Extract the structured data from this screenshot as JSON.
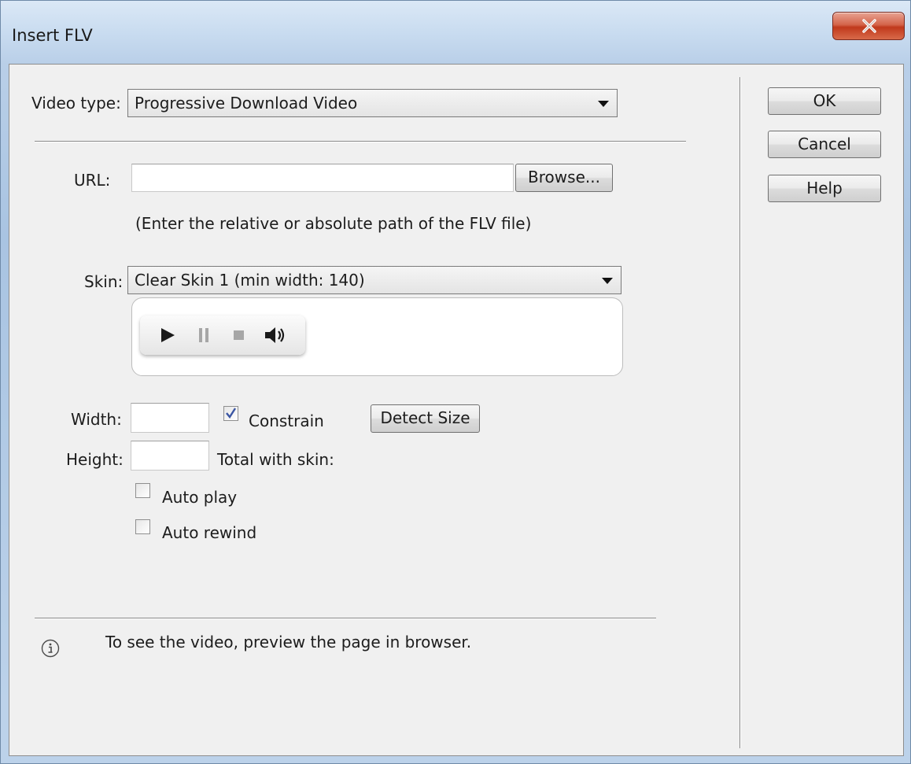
{
  "window": {
    "title": "Insert FLV",
    "close_glyph": "x"
  },
  "video_type": {
    "label": "Video type:",
    "value": "Progressive Download Video"
  },
  "url": {
    "label": "URL:",
    "value": "",
    "browse_label": "Browse...",
    "hint": "(Enter the relative or absolute path of the FLV file)"
  },
  "skin": {
    "label": "Skin:",
    "value": "Clear Skin 1 (min width: 140)",
    "preview_icons": [
      "play-icon",
      "pause-icon",
      "stop-icon",
      "volume-icon"
    ]
  },
  "size": {
    "width_label": "Width:",
    "width_value": "",
    "height_label": "Height:",
    "height_value": "",
    "constrain_label": "Constrain",
    "constrain_checked": true,
    "detect_label": "Detect Size",
    "total_label": "Total with skin:"
  },
  "options": {
    "auto_play_label": "Auto play",
    "auto_play_checked": false,
    "auto_rewind_label": "Auto rewind",
    "auto_rewind_checked": false
  },
  "info": {
    "icon": "info-icon",
    "text": "To see the video, preview the page in browser."
  },
  "buttons": {
    "ok": "OK",
    "cancel": "Cancel",
    "help": "Help"
  },
  "colors": {
    "close_button": "#c7452a",
    "dialog_background": "#f0f0f0",
    "check_mark": "#3a55a3"
  }
}
